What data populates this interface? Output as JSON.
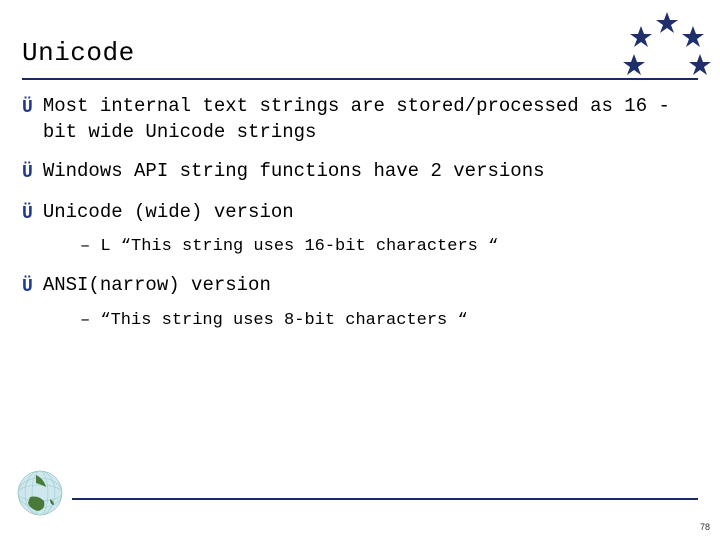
{
  "title": "Unicode",
  "bullets": [
    {
      "text": "Most internal text strings are stored/processed as 16\n-bit wide Unicode strings"
    },
    {
      "text": "Windows API string functions have 2 versions"
    },
    {
      "text": "Unicode (wide) version",
      "sub": [
        "L “This string uses 16-bit characters “"
      ]
    },
    {
      "text": "ANSI(narrow) version",
      "sub": [
        " “This string uses 8-bit characters “"
      ]
    }
  ],
  "page_number": "78"
}
